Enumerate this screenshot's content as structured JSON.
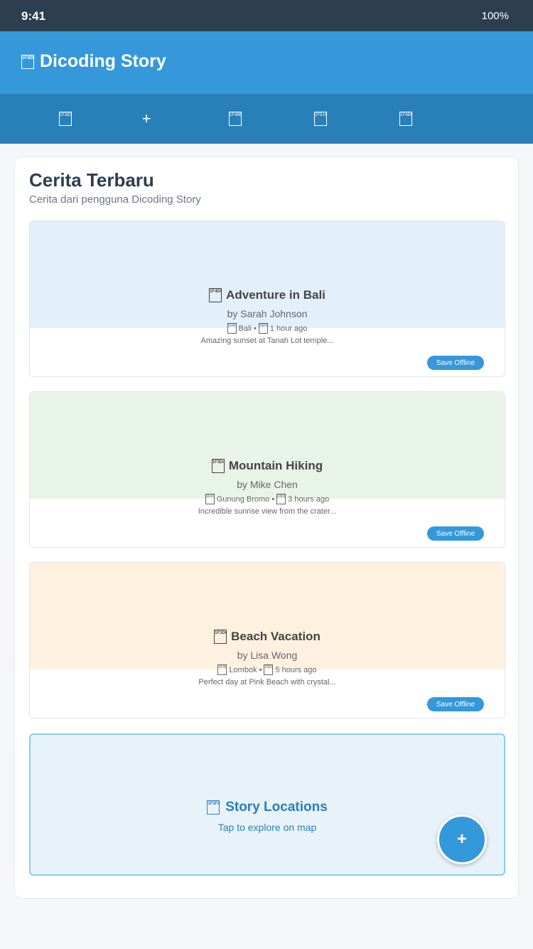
{
  "status_bar": {
    "time": "9:41",
    "battery": "100%"
  },
  "header": {
    "icon": "book-icon",
    "icon_glyph": "1F4D6",
    "title": "Dicoding Story"
  },
  "nav": {
    "items": [
      {
        "name": "home",
        "icon": "home-icon",
        "glyph": "1F3E0"
      },
      {
        "name": "add",
        "icon": "plus-icon",
        "glyph": "+"
      },
      {
        "name": "bookmark",
        "icon": "bookmark-icon",
        "glyph": "1F48E"
      },
      {
        "name": "notifications",
        "icon": "bell-icon",
        "glyph": "1F514"
      },
      {
        "name": "profile",
        "icon": "user-icon",
        "glyph": "1F464"
      }
    ]
  },
  "main": {
    "title": "Cerita Terbaru",
    "subtitle": "Cerita dari pengguna Dicoding Story",
    "stories": [
      {
        "title": "Adventure in Bali",
        "icon": "book-icon",
        "icon_glyph": "1F4D6",
        "author": "by Sarah Johnson",
        "location": "Bali",
        "time": "1 hour ago",
        "excerpt": "Amazing sunset at Tanah Lot temple...",
        "save_label": "Save Offline",
        "banner_color": "#e3f0fc"
      },
      {
        "title": "Mountain Hiking",
        "icon": "mountain-icon",
        "icon_glyph": "1F3D4",
        "author": "by Mike Chen",
        "location": "Gunung Bromo",
        "time": "3 hours ago",
        "excerpt": "Incredible sunrise view from the crater...",
        "save_label": "Save Offline",
        "banner_color": "#e8f4e8"
      },
      {
        "title": "Beach Vacation",
        "icon": "beach-icon",
        "icon_glyph": "1F3D6",
        "author": "by Lisa Wong",
        "location": "Lombok",
        "time": "5 hours ago",
        "excerpt": "Perfect day at Pink Beach with crystal...",
        "save_label": "Save Offline",
        "banner_color": "#fef1e0"
      }
    ],
    "locations": {
      "icon": "map-icon",
      "icon_glyph": "1F5FA",
      "title": "Story Locations",
      "subtitle": "Tap to explore on map"
    }
  },
  "fab": {
    "label": "+"
  },
  "colors": {
    "primary": "#3498db",
    "nav": "#2980b9",
    "status": "#2c3e50"
  }
}
